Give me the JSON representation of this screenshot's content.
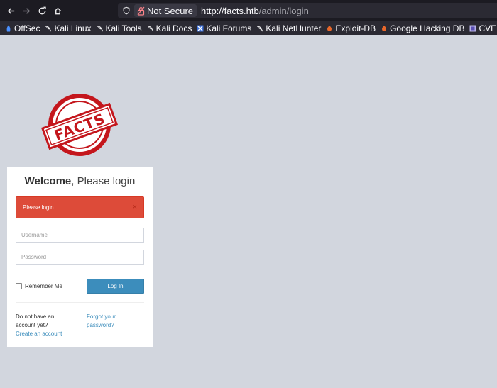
{
  "browser": {
    "url_security_label": "Not Secure",
    "url_host": "http://facts.htb",
    "url_path": "/admin/login",
    "bookmarks": [
      {
        "label": "OffSec",
        "icon": "offsec-icon"
      },
      {
        "label": "Kali Linux",
        "icon": "kali-dragon-icon"
      },
      {
        "label": "Kali Tools",
        "icon": "kali-dragon-icon"
      },
      {
        "label": "Kali Docs",
        "icon": "kali-dragon-icon"
      },
      {
        "label": "Kali Forums",
        "icon": "kali-forums-icon"
      },
      {
        "label": "Kali NetHunter",
        "icon": "kali-dragon-icon"
      },
      {
        "label": "Exploit-DB",
        "icon": "exploit-db-icon"
      },
      {
        "label": "Google Hacking DB",
        "icon": "exploit-db-icon"
      },
      {
        "label": "CVE secu",
        "icon": "cve-icon"
      }
    ]
  },
  "logo": {
    "text": "FACTS",
    "color": "#c4161c"
  },
  "login": {
    "title_bold": "Welcome",
    "title_rest": ", Please login",
    "alert_text": "Please login",
    "alert_close": "×",
    "username_placeholder": "Username",
    "password_placeholder": "Password",
    "remember_label": "Remember Me",
    "login_button": "Log In",
    "no_account_text": "Do not have an account yet?",
    "create_account_link": "Create an account",
    "forgot_password_link": "Forgot your password?"
  },
  "colors": {
    "page_bg": "#d2d6de",
    "alert_bg": "#dd4b39",
    "primary": "#3c8dbc"
  }
}
